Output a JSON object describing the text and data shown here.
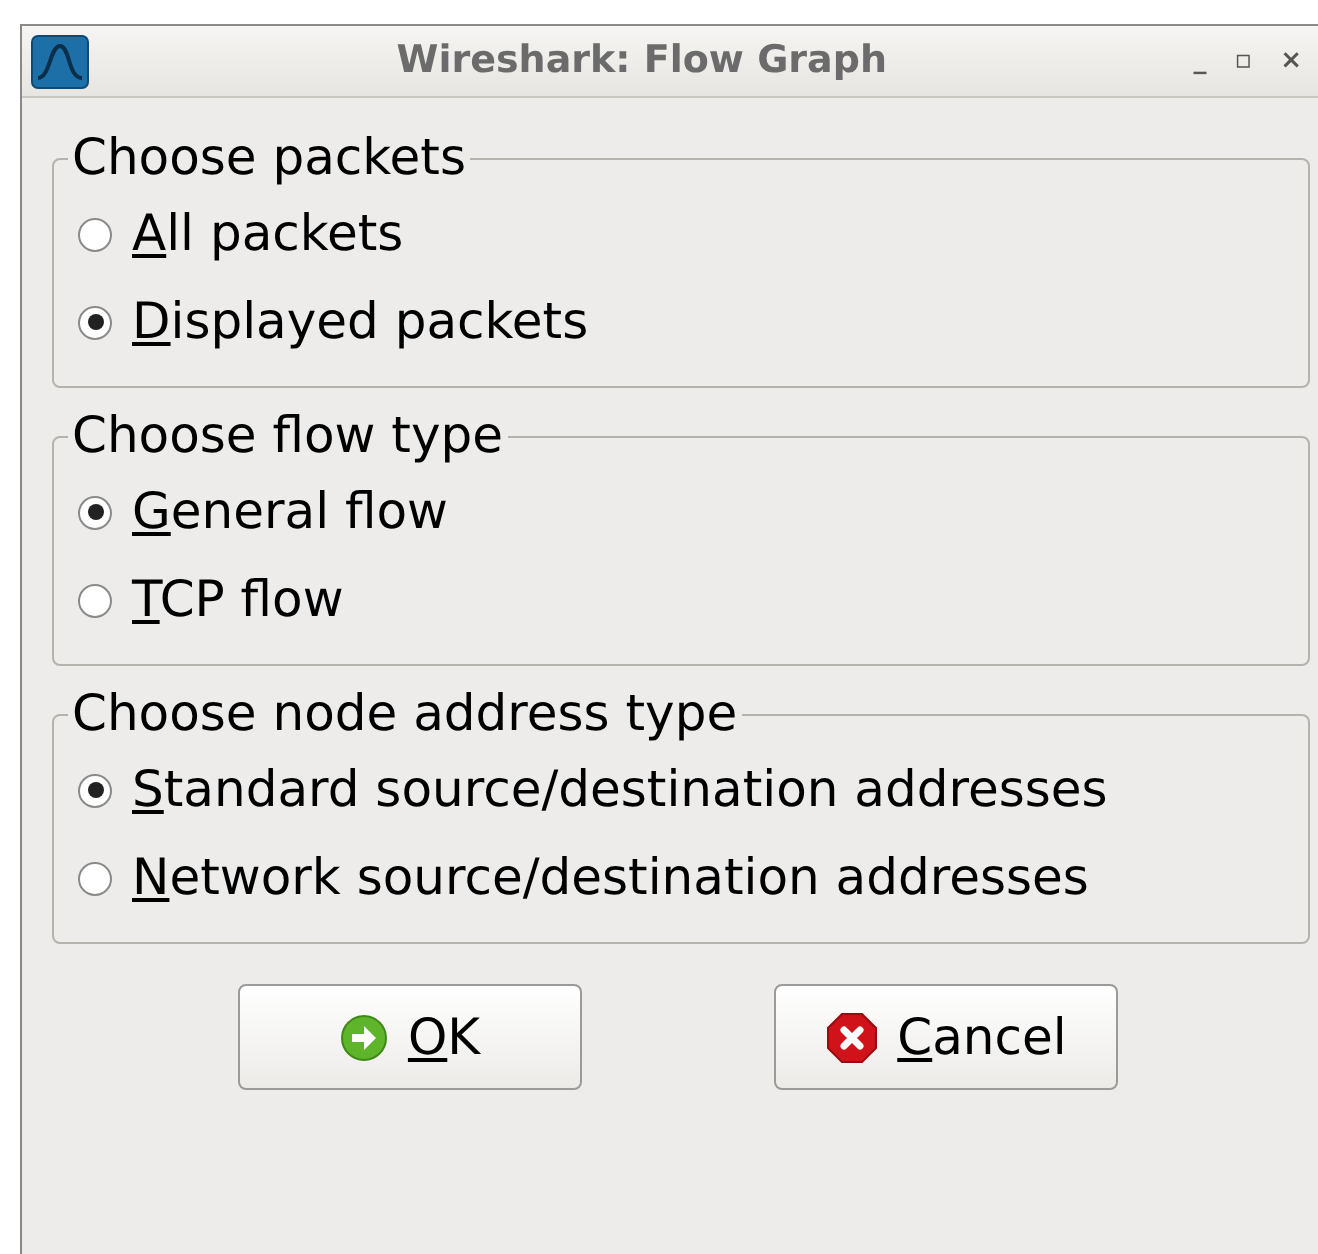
{
  "window": {
    "title": "Wireshark: Flow Graph",
    "controls": [
      "_",
      "▫",
      "×"
    ]
  },
  "groups": [
    {
      "title": "Choose packets",
      "options": [
        {
          "label": "All packets",
          "selected": false
        },
        {
          "label": "Displayed packets",
          "selected": true
        }
      ]
    },
    {
      "title": "Choose flow type",
      "options": [
        {
          "label": "General flow",
          "selected": true
        },
        {
          "label": "TCP flow",
          "selected": false
        }
      ]
    },
    {
      "title": "Choose node address type",
      "options": [
        {
          "label": "Standard source/destination addresses",
          "selected": true
        },
        {
          "label": "Network source/destination addresses",
          "selected": false
        }
      ]
    }
  ],
  "buttons": [
    {
      "label": "OK",
      "kind": "ok"
    },
    {
      "label": "Cancel",
      "kind": "cancel"
    }
  ]
}
